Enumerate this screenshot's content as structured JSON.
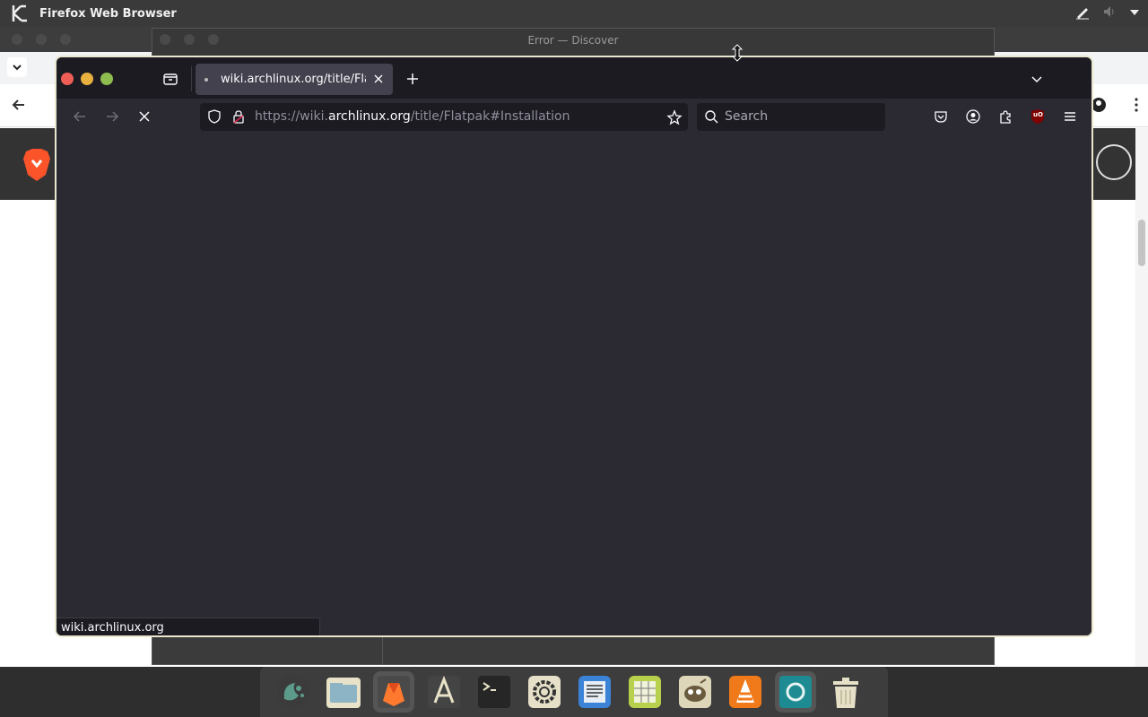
{
  "top_panel": {
    "app_title": "Firefox Web Browser"
  },
  "discover_window": {
    "title": "Error — Discover"
  },
  "firefox": {
    "tab": {
      "title": "wiki.archlinux.org/title/Flatpak#Installation"
    },
    "url": {
      "prefix": "https://wiki.",
      "host": "archlinux.org",
      "path": "/title/Flatpak#Installation"
    },
    "search": {
      "placeholder": "Search"
    },
    "status_text": "wiki.archlinux.org",
    "ublock_badge": "uO"
  },
  "dock": {
    "items": [
      {
        "name": "KDE Plasma",
        "icon": "plasma-icon",
        "color": "#5c9b8a"
      },
      {
        "name": "Files",
        "icon": "folder-icon",
        "color": "#e8e3c8"
      },
      {
        "name": "Firefox",
        "icon": "firefox-icon",
        "color": "#ff7a2f"
      },
      {
        "name": "App Store",
        "icon": "app-store-icon",
        "color": "#444"
      },
      {
        "name": "Terminal",
        "icon": "terminal-icon",
        "color": "#2a2a2a"
      },
      {
        "name": "Settings",
        "icon": "settings-icon",
        "color": "#e6e0c8"
      },
      {
        "name": "Writer",
        "icon": "writer-icon",
        "color": "#3b83d6"
      },
      {
        "name": "Calc",
        "icon": "calc-icon",
        "color": "#b8d14d"
      },
      {
        "name": "GIMP",
        "icon": "gimp-icon",
        "color": "#ddd6b8"
      },
      {
        "name": "VLC",
        "icon": "vlc-icon",
        "color": "#f07a1a"
      },
      {
        "name": "Screenshot",
        "icon": "screenshot-icon",
        "color": "#1e8b93"
      },
      {
        "name": "Trash",
        "icon": "trash-icon",
        "color": "#e6e0c8"
      }
    ]
  },
  "colors": {
    "firefox_bg": "#2b2a33",
    "tabbar_bg": "#1c1b22",
    "accent_close": "#ee5e56",
    "accent_min": "#e8b03f",
    "accent_max": "#8fbc4f"
  }
}
